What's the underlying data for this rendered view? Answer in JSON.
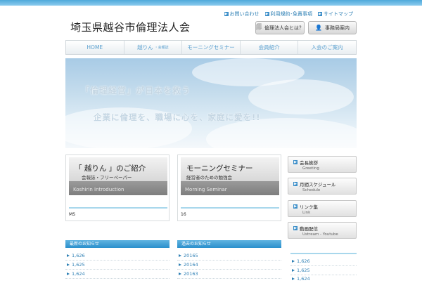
{
  "site": {
    "title": "埼玉県越谷市倫理法人会"
  },
  "top_links": [
    {
      "label": "お問い合わせ"
    },
    {
      "label": "利用規約･免責事項"
    },
    {
      "label": "サイトマップ"
    }
  ],
  "header_buttons": [
    {
      "label": "倫理法人会とは？"
    },
    {
      "label": "事務局案内"
    }
  ],
  "nav": [
    {
      "label": "HOME",
      "sub": ""
    },
    {
      "label": "越りん",
      "sub": "・会報誌"
    },
    {
      "label": "モーニングセミナー",
      "sub": ""
    },
    {
      "label": "会員紹介",
      "sub": ""
    },
    {
      "label": "入会のご案内",
      "sub": ""
    }
  ],
  "hero": {
    "line1": "「倫理経営」が日本を救う",
    "line2": "企業に倫理を、職場に心を、家庭に愛を!!"
  },
  "cards": [
    {
      "title": "「 越りん 」のご紹介",
      "subtitle": "会報誌・フリーペーパー",
      "banner_en": "Koshirin Introduction",
      "footer": "MS"
    },
    {
      "title": "モーニングセミナー",
      "subtitle": "経営者のための勉強会",
      "banner_en": "Morning Seminar",
      "footer": "16"
    }
  ],
  "side_menu": [
    {
      "label": "会長挨拶",
      "sub": "Greeting"
    },
    {
      "label": "月間スケジュール",
      "sub": "Schedule"
    },
    {
      "label": "リンク集",
      "sub": "Link"
    },
    {
      "label": "動画配信",
      "sub": "Ustream - Youtube"
    }
  ],
  "panels": {
    "latest": {
      "header": "最新のお知らせ",
      "items": [
        "1,626",
        "1,625",
        "1,624"
      ]
    },
    "past": {
      "header": "過去のお知らせ",
      "items": [
        "20165",
        "20164",
        "20163"
      ]
    },
    "right": {
      "items": [
        "1,626",
        "1,625",
        "1,624"
      ]
    }
  },
  "colors": {
    "accent": "#2d7fb4",
    "header_band": "#4fa9db",
    "panel_header": "#2b90cc"
  }
}
